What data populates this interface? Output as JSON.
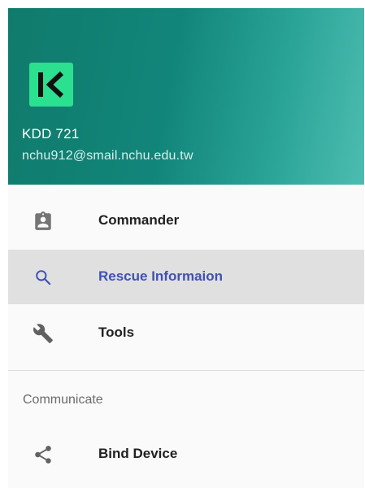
{
  "header": {
    "logo_icon": "k-logo-icon",
    "accent_color": "#2be08f",
    "name": "KDD 721",
    "email": "nchu912@smail.nchu.edu.tw"
  },
  "menu": {
    "items": [
      {
        "label": "Commander",
        "icon": "clipboard-person-icon",
        "selected": false
      },
      {
        "label": "Rescue Informaion",
        "icon": "search-icon",
        "selected": true
      },
      {
        "label": "Tools",
        "icon": "wrench-icon",
        "selected": false
      }
    ],
    "section_header": "Communicate",
    "section_items": [
      {
        "label": "Bind Device",
        "icon": "share-icon",
        "selected": false
      }
    ],
    "selected_color": "#3f51b5"
  }
}
